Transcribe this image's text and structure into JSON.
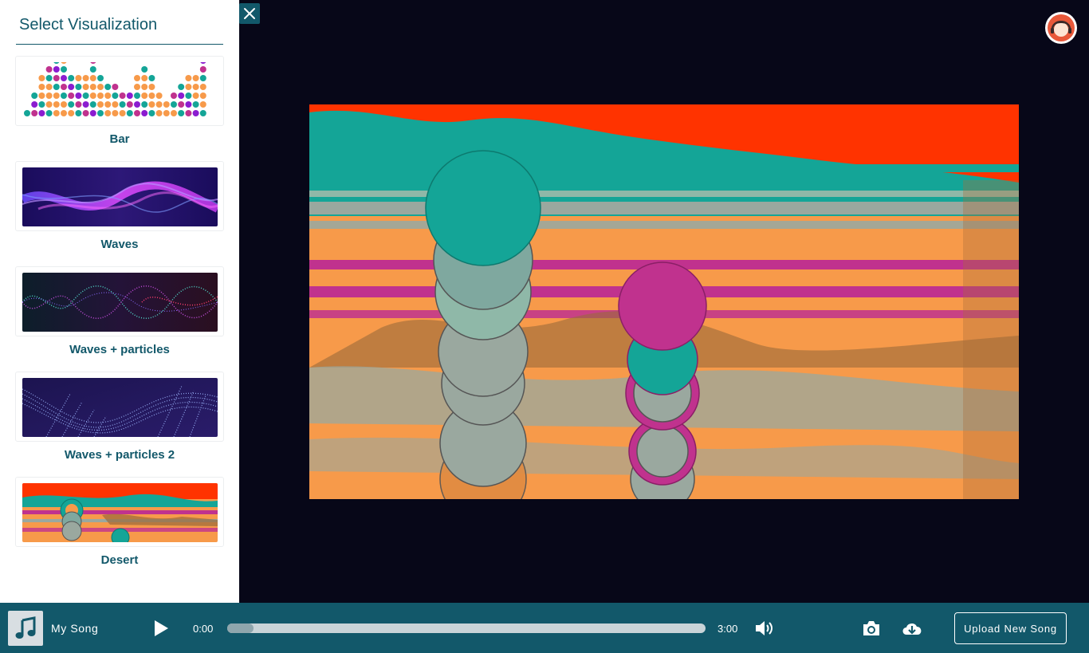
{
  "sidebar": {
    "title": "Select Visualization",
    "items": [
      {
        "label": "Bar"
      },
      {
        "label": "Waves"
      },
      {
        "label": "Waves + particles"
      },
      {
        "label": "Waves + particles 2"
      },
      {
        "label": "Desert"
      }
    ]
  },
  "player": {
    "song_title": "My Song",
    "current_time": "0:00",
    "duration": "3:00",
    "progress_fraction": 0.055,
    "upload_label": "Upload New Song"
  },
  "colors": {
    "brand": "#12586a",
    "accent_orange": "#f79a4a",
    "accent_teal": "#14a597",
    "accent_magenta": "#c0328e",
    "accent_purple": "#8b1cd0",
    "desert_red": "#ff3300"
  },
  "icons": {
    "close": "close-icon",
    "avatar": "avatar-icon",
    "album": "music-note-icon",
    "play": "play-icon",
    "volume": "volume-icon",
    "camera": "camera-icon",
    "download": "cloud-download-icon"
  }
}
